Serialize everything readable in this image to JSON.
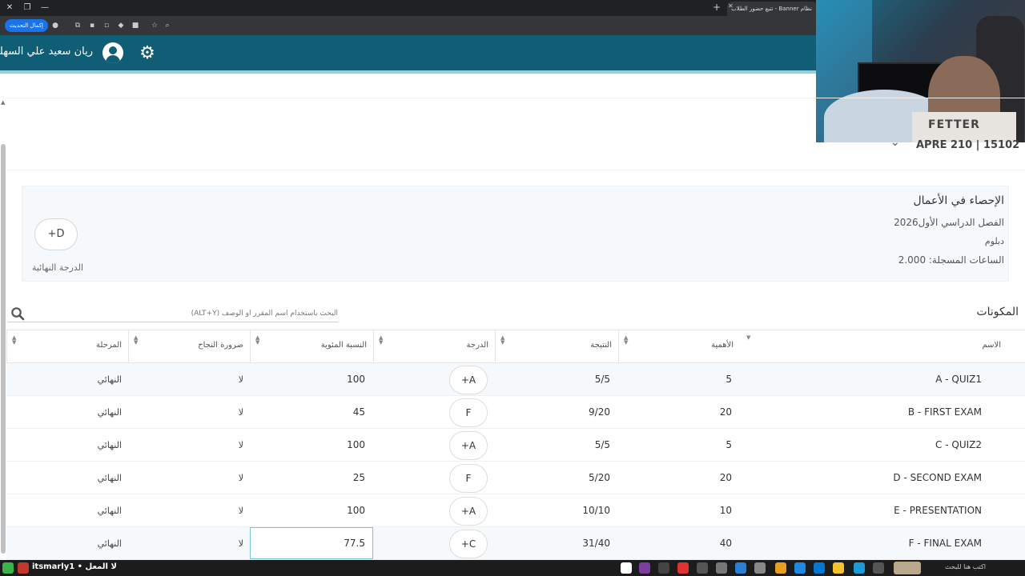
{
  "browser": {
    "tab_title": "نظام Banner - تتبع حضور الطلاب",
    "update_button": "إكمال التحديث"
  },
  "header": {
    "user_name": "ريان سعيد علي السهلي"
  },
  "course": {
    "code": "APRE 210 | 15102",
    "title": "الإحصاء في الأعمال",
    "semester": "الفصل الدراسي الأول2026",
    "level": "دبلوم",
    "hours": "الساعات المسجلة: 2.000",
    "final_grade": "+D",
    "final_grade_label": "الدرجة النهائية"
  },
  "components": {
    "title": "المكونات",
    "search_placeholder": "البحث باستخدام اسم المقرر أو الوصف (ALT+Y)"
  },
  "table": {
    "headers": {
      "name": "الاسم",
      "weight": "الأهمية",
      "score": "النتيجة",
      "grade": "الدرجة",
      "percent": "النسبة المئوية",
      "required": "ضرورة النجاح",
      "stage": "المرحلة"
    },
    "rows": [
      {
        "name": "A - QUIZ1",
        "weight": "5",
        "score": "5/5",
        "grade": "+A",
        "percent": "100",
        "required": "لا",
        "stage": "النهائي"
      },
      {
        "name": "B - FIRST EXAM",
        "weight": "20",
        "score": "9/20",
        "grade": "F",
        "percent": "45",
        "required": "لا",
        "stage": "النهائي"
      },
      {
        "name": "C - QUIZ2",
        "weight": "5",
        "score": "5/5",
        "grade": "+A",
        "percent": "100",
        "required": "لا",
        "stage": "النهائي"
      },
      {
        "name": "D - SECOND EXAM",
        "weight": "20",
        "score": "5/20",
        "grade": "F",
        "percent": "25",
        "required": "لا",
        "stage": "النهائي"
      },
      {
        "name": "E - PRESENTATION",
        "weight": "10",
        "score": "10/10",
        "grade": "+A",
        "percent": "100",
        "required": "لا",
        "stage": "النهائي"
      },
      {
        "name": "F - FINAL EXAM",
        "weight": "40",
        "score": "31/40",
        "grade": "+C",
        "percent": "77.5",
        "required": "لا",
        "stage": "النهائي"
      }
    ]
  },
  "taskbar": {
    "status": "itsmarly1 • لا المعل",
    "search_text": "اكتب هنا للبحث"
  },
  "webcam": {
    "shirt_text": "FETTER"
  },
  "colors": {
    "header": "#0f5e76",
    "header_strip": "#8fd0e2",
    "panel": "#f6f9fb"
  }
}
